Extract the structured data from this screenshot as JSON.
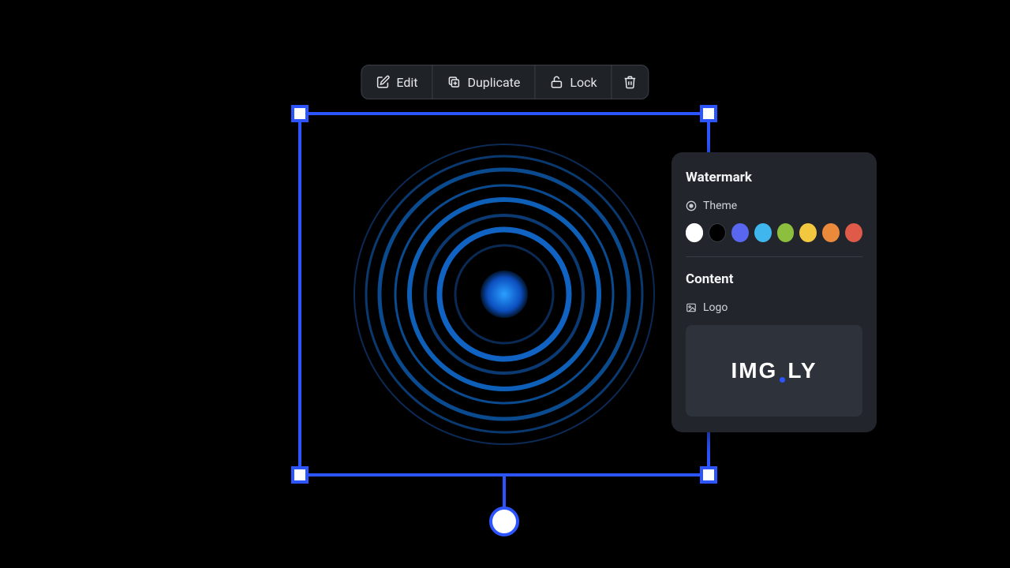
{
  "toolbar": {
    "edit": "Edit",
    "duplicate": "Duplicate",
    "lock": "Lock"
  },
  "panel": {
    "title": "Watermark",
    "theme_label": "Theme",
    "content_label": "Content",
    "logo_label": "Logo",
    "logo_text_a": "IMG",
    "logo_text_b": "LY",
    "colors": [
      {
        "name": "white",
        "hex": "#ffffff",
        "selected": true
      },
      {
        "name": "black",
        "hex": "#000000",
        "selected": false
      },
      {
        "name": "indigo",
        "hex": "#5966f0",
        "selected": false
      },
      {
        "name": "sky",
        "hex": "#3fb7ee",
        "selected": false
      },
      {
        "name": "green",
        "hex": "#8bbf3d",
        "selected": false
      },
      {
        "name": "yellow",
        "hex": "#f2c83f",
        "selected": false
      },
      {
        "name": "orange",
        "hex": "#ec8a3c",
        "selected": false
      },
      {
        "name": "red",
        "hex": "#e05a4a",
        "selected": false
      }
    ]
  }
}
